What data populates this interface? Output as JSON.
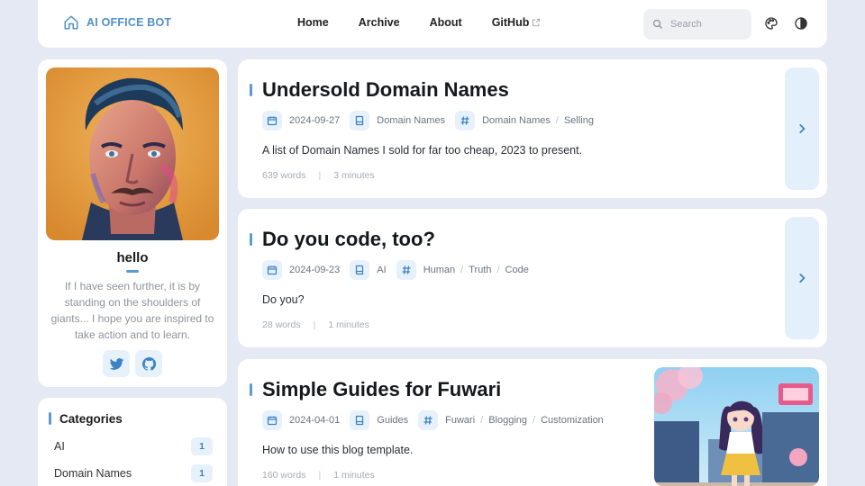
{
  "navbar": {
    "brand": "AI OFFICE BOT",
    "links": [
      "Home",
      "Archive",
      "About",
      "GitHub"
    ],
    "search_placeholder": "Search",
    "icons": [
      "home-icon",
      "external-link-icon",
      "search-icon",
      "palette-icon",
      "contrast-icon"
    ]
  },
  "profile": {
    "name": "hello",
    "bio": "If I have seen further, it is by standing on the shoulders of giants... I hope you are inspired to take action and to learn.",
    "socials": [
      "twitter-icon",
      "github-icon"
    ]
  },
  "categories": {
    "title": "Categories",
    "items": [
      {
        "label": "AI",
        "count": "1"
      },
      {
        "label": "Domain Names",
        "count": "1"
      }
    ]
  },
  "posts": [
    {
      "title": "Undersold Domain Names",
      "date": "2024-09-27",
      "category": "Domain Names",
      "tags": [
        "Domain Names",
        "Selling"
      ],
      "description": "A list of Domain Names I sold for far too cheap, 2023 to present.",
      "words": "639 words",
      "minutes": "3 minutes"
    },
    {
      "title": "Do you code, too?",
      "date": "2024-09-23",
      "category": "AI",
      "tags": [
        "Human",
        "Truth",
        "Code"
      ],
      "description": "Do you?",
      "words": "28 words",
      "minutes": "1 minutes"
    },
    {
      "title": "Simple Guides for Fuwari",
      "date": "2024-04-01",
      "category": "Guides",
      "tags": [
        "Fuwari",
        "Blogging",
        "Customization"
      ],
      "description": "How to use this blog template.",
      "words": "160 words",
      "minutes": "1 minutes"
    }
  ],
  "colors": {
    "accent": "#5b9bd5",
    "background": "#e4e9f3",
    "brand": "#4f8fc9"
  }
}
